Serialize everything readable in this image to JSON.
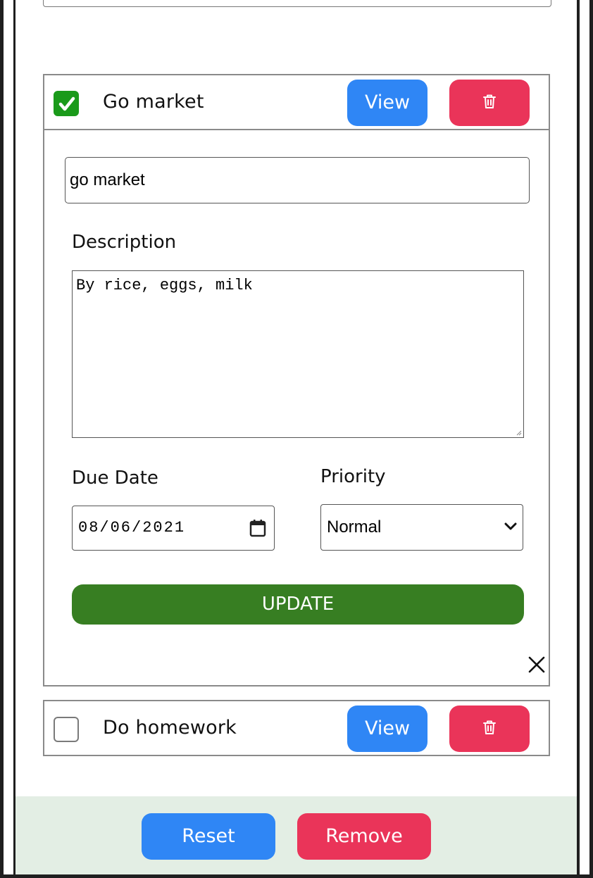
{
  "todos": [
    {
      "title": "Go market",
      "checked": true,
      "view_label": "View",
      "delete_icon": "trash-icon",
      "expanded": true,
      "detail": {
        "title_value": "go market",
        "description_label": "Description",
        "description_value": "By rice, eggs, milk",
        "due_date_label": "Due Date",
        "due_date_value": "08/06/2021",
        "priority_label": "Priority",
        "priority_value": "Normal",
        "update_label": "UPDATE"
      }
    },
    {
      "title": "Do homework",
      "checked": false,
      "view_label": "View",
      "delete_icon": "trash-icon",
      "expanded": false
    }
  ],
  "footer": {
    "reset_label": "Reset",
    "remove_label": "Remove"
  },
  "colors": {
    "view_button": "#2f86f5",
    "delete_button": "#ea3459",
    "update_button": "#377e22",
    "checkbox_checked": "#1a9a1a",
    "footer_bg": "#e3eee4"
  }
}
